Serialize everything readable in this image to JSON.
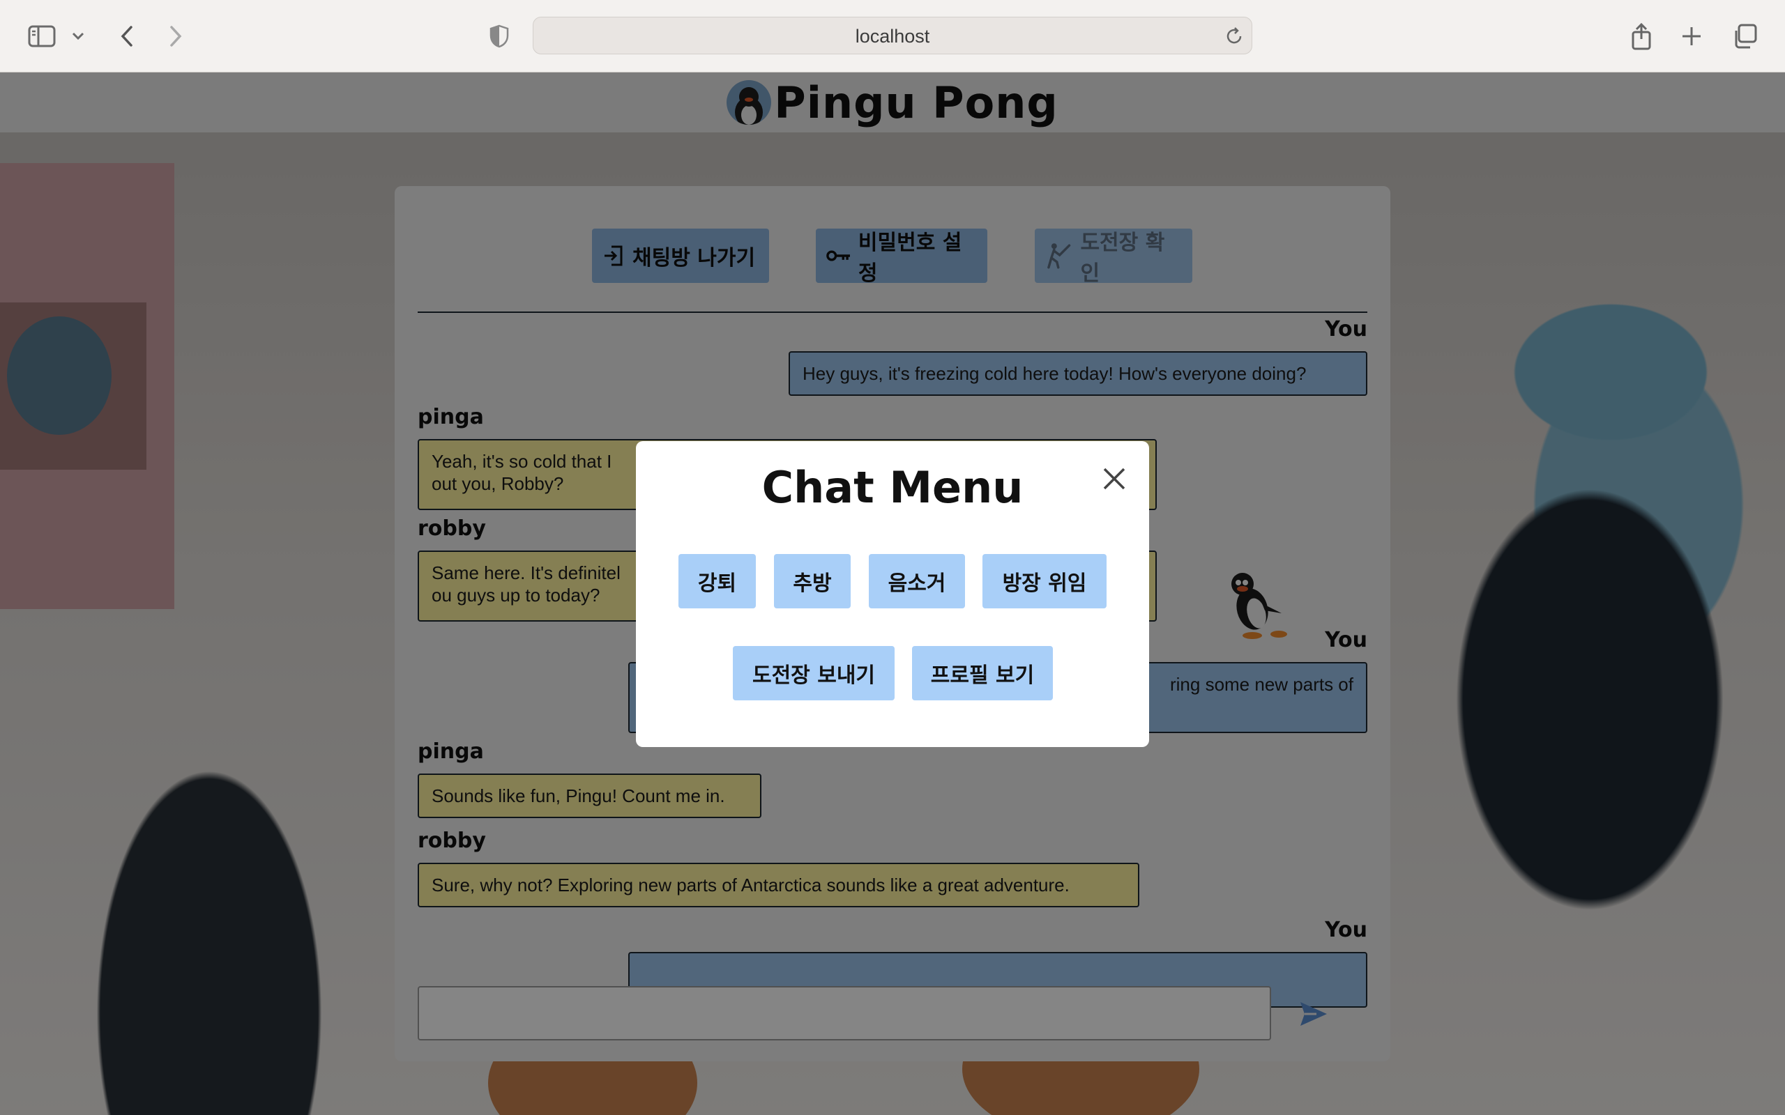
{
  "browser": {
    "url": "localhost"
  },
  "app": {
    "title": "Pingu Pong"
  },
  "chat": {
    "top_buttons": {
      "leave": "채팅방 나가기",
      "password": "비밀번호 설정",
      "challenge": "도전장 확인"
    },
    "messages": [
      {
        "sender": "You",
        "text": "Hey guys, it's freezing cold here today! How's everyone doing?"
      },
      {
        "sender": "pinga",
        "text_line1": "Yeah, it's so cold that I",
        "text_line2": "out you, Robby?"
      },
      {
        "sender": "robby",
        "text_line1": "Same here. It's definitel",
        "text_line2": "ou guys up to today?"
      },
      {
        "sender": "You",
        "text": "ring some new parts of"
      },
      {
        "sender": "pinga",
        "text": "Sounds like fun, Pingu! Count me in."
      },
      {
        "sender": "robby",
        "text": "Sure, why not? Exploring new parts of Antarctica sounds like a great adventure."
      },
      {
        "sender": "You",
        "text": ""
      }
    ],
    "input_value": ""
  },
  "modal": {
    "title": "Chat Menu",
    "buttons": {
      "kick": "강퇴",
      "ban": "추방",
      "mute": "음소거",
      "delegate": "방장 위임",
      "send_challenge": "도전장 보내기",
      "view_profile": "프로필 보기"
    }
  },
  "colors": {
    "my_bubble": "#9cc3ec",
    "their_bubble": "#fff3a0",
    "button": "#8fb6e0",
    "modal_button": "#a9cff8"
  }
}
